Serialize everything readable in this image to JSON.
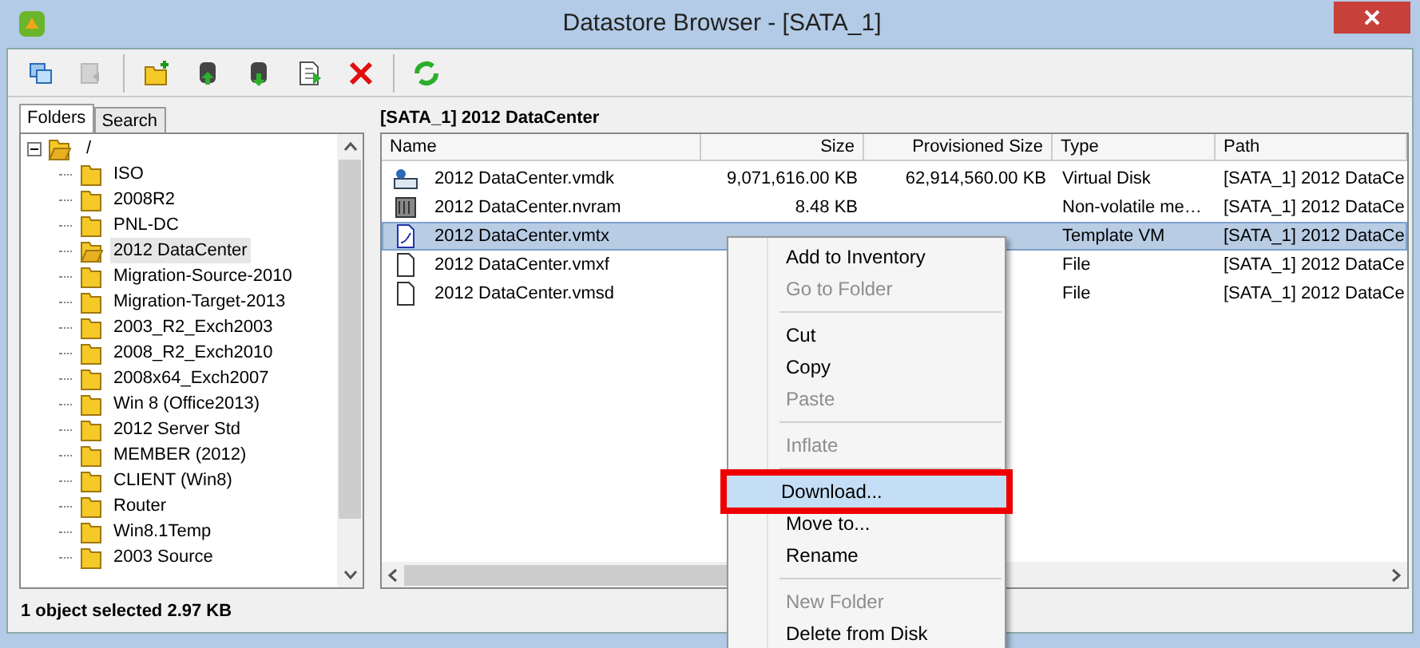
{
  "window": {
    "title": "Datastore Browser - [SATA_1]"
  },
  "toolbar": [
    {
      "kind": "browse",
      "disabled": false
    },
    {
      "kind": "back",
      "disabled": true
    },
    {
      "kind": "new-folder",
      "disabled": false
    },
    {
      "kind": "upload",
      "disabled": false
    },
    {
      "kind": "download",
      "disabled": false
    },
    {
      "kind": "move",
      "disabled": false
    },
    {
      "kind": "delete",
      "disabled": false
    },
    {
      "kind": "refresh",
      "disabled": false
    }
  ],
  "tabs": [
    {
      "label": "Folders",
      "selected": true
    },
    {
      "label": "Search",
      "selected": false
    }
  ],
  "tree": {
    "label": "/",
    "expanded": true,
    "children": [
      {
        "label": "ISO",
        "selected": false
      },
      {
        "label": "2008R2",
        "selected": false
      },
      {
        "label": "PNL-DC",
        "selected": false
      },
      {
        "label": "2012 DataCenter",
        "selected": true
      },
      {
        "label": "Migration-Source-2010",
        "selected": false
      },
      {
        "label": "Migration-Target-2013",
        "selected": false
      },
      {
        "label": "2003_R2_Exch2003",
        "selected": false
      },
      {
        "label": "2008_R2_Exch2010",
        "selected": false
      },
      {
        "label": "2008x64_Exch2007",
        "selected": false
      },
      {
        "label": "Win 8 (Office2013)",
        "selected": false
      },
      {
        "label": "2012 Server Std",
        "selected": false
      },
      {
        "label": "MEMBER (2012)",
        "selected": false
      },
      {
        "label": "CLIENT (Win8)",
        "selected": false
      },
      {
        "label": "Router",
        "selected": false
      },
      {
        "label": "Win8.1Temp",
        "selected": false
      },
      {
        "label": "2003 Source",
        "selected": false
      }
    ]
  },
  "path_label": "[SATA_1] 2012 DataCenter",
  "table": {
    "columns": [
      "Name",
      "Size",
      "Provisioned Size",
      "Type",
      "Path"
    ],
    "rows": [
      {
        "kind": "disk",
        "name": "2012 DataCenter.vmdk",
        "size": "9,071,616.00 KB",
        "provisioned": "62,914,560.00 KB",
        "type": "Virtual Disk",
        "path": "[SATA_1] 2012 DataCe",
        "selected": false
      },
      {
        "kind": "nvram",
        "name": "2012 DataCenter.nvram",
        "size": "8.48 KB",
        "provisioned": "",
        "type": "Non-volatile me…",
        "path": "[SATA_1] 2012 DataCe",
        "selected": false
      },
      {
        "kind": "template",
        "name": "2012 DataCenter.vmtx",
        "size": "",
        "provisioned": "",
        "type": "Template VM",
        "path": "[SATA_1] 2012 DataCe",
        "selected": true
      },
      {
        "kind": "file",
        "name": "2012 DataCenter.vmxf",
        "size": "",
        "provisioned": "",
        "type": "File",
        "path": "[SATA_1] 2012 DataCe",
        "selected": false
      },
      {
        "kind": "file",
        "name": "2012 DataCenter.vmsd",
        "size": "",
        "provisioned": "",
        "type": "File",
        "path": "[SATA_1] 2012 DataCe",
        "selected": false
      }
    ]
  },
  "status_bar": "1 object selected 2.97 KB",
  "context_menu": [
    {
      "kind": "item",
      "label": "Add to Inventory",
      "disabled": false,
      "selected": false,
      "outlined": false
    },
    {
      "kind": "item",
      "label": "Go to Folder",
      "disabled": true,
      "selected": false,
      "outlined": false
    },
    {
      "kind": "separator"
    },
    {
      "kind": "item",
      "label": "Cut",
      "disabled": false,
      "selected": false,
      "outlined": false
    },
    {
      "kind": "item",
      "label": "Copy",
      "disabled": false,
      "selected": false,
      "outlined": false
    },
    {
      "kind": "item",
      "label": "Paste",
      "disabled": true,
      "selected": false,
      "outlined": false
    },
    {
      "kind": "separator"
    },
    {
      "kind": "item",
      "label": "Inflate",
      "disabled": true,
      "selected": false,
      "outlined": false
    },
    {
      "kind": "separator"
    },
    {
      "kind": "item",
      "label": "Download...",
      "disabled": false,
      "selected": true,
      "outlined": true
    },
    {
      "kind": "item",
      "label": "Move to...",
      "disabled": false,
      "selected": false,
      "outlined": false
    },
    {
      "kind": "item",
      "label": "Rename",
      "disabled": false,
      "selected": false,
      "outlined": false
    },
    {
      "kind": "separator"
    },
    {
      "kind": "item",
      "label": "New Folder",
      "disabled": true,
      "selected": false,
      "outlined": false
    },
    {
      "kind": "item",
      "label": "Delete from Disk",
      "disabled": false,
      "selected": false,
      "outlined": false
    }
  ]
}
